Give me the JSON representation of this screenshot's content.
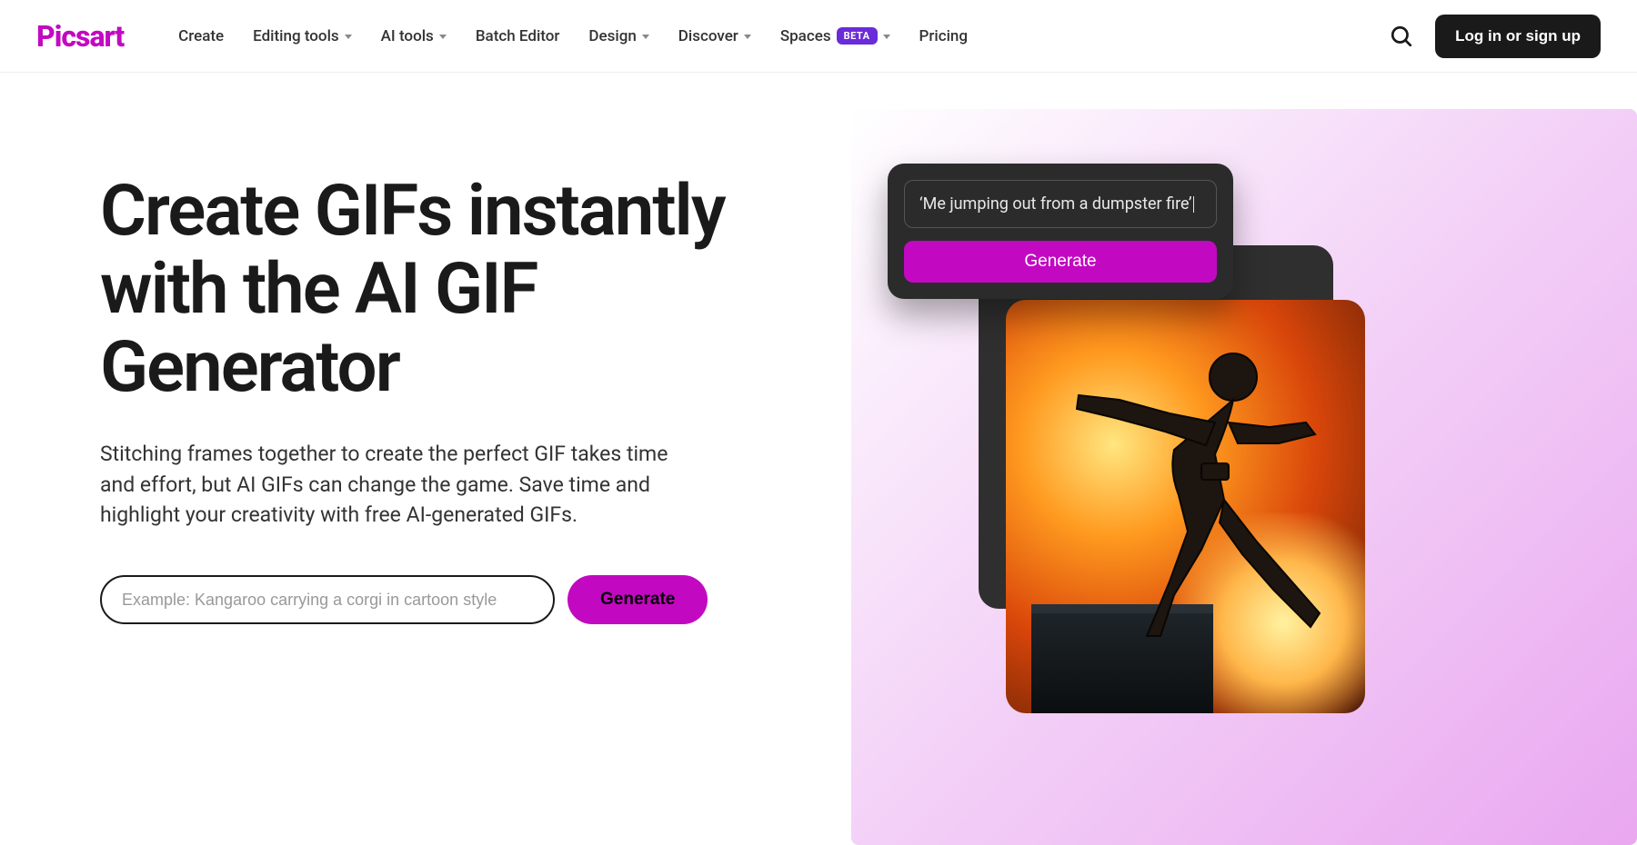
{
  "header": {
    "logo": "Picsart",
    "nav": [
      {
        "label": "Create",
        "dropdown": false
      },
      {
        "label": "Editing tools",
        "dropdown": true
      },
      {
        "label": "AI tools",
        "dropdown": true
      },
      {
        "label": "Batch Editor",
        "dropdown": false
      },
      {
        "label": "Design",
        "dropdown": true
      },
      {
        "label": "Discover",
        "dropdown": true
      },
      {
        "label": "Spaces",
        "dropdown": true,
        "badge": "BETA"
      },
      {
        "label": "Pricing",
        "dropdown": false
      }
    ],
    "login": "Log in or sign up"
  },
  "hero": {
    "title": "Create GIFs instantly with the AI GIF Generator",
    "description": "Stitching frames together to create the perfect GIF takes time and effort, but AI GIFs can change the game. Save time and highlight your creativity with free AI-generated GIFs.",
    "input_placeholder": "Example: Kangaroo carrying a corgi in cartoon style",
    "input_value": "",
    "generate_label": "Generate"
  },
  "visual": {
    "popup_prompt": "‘Me jumping out from a dumpster fire’",
    "popup_button": "Generate"
  },
  "colors": {
    "brand": "#c209c1",
    "dark": "#1a1a1a",
    "badge": "#6b2bd9"
  }
}
